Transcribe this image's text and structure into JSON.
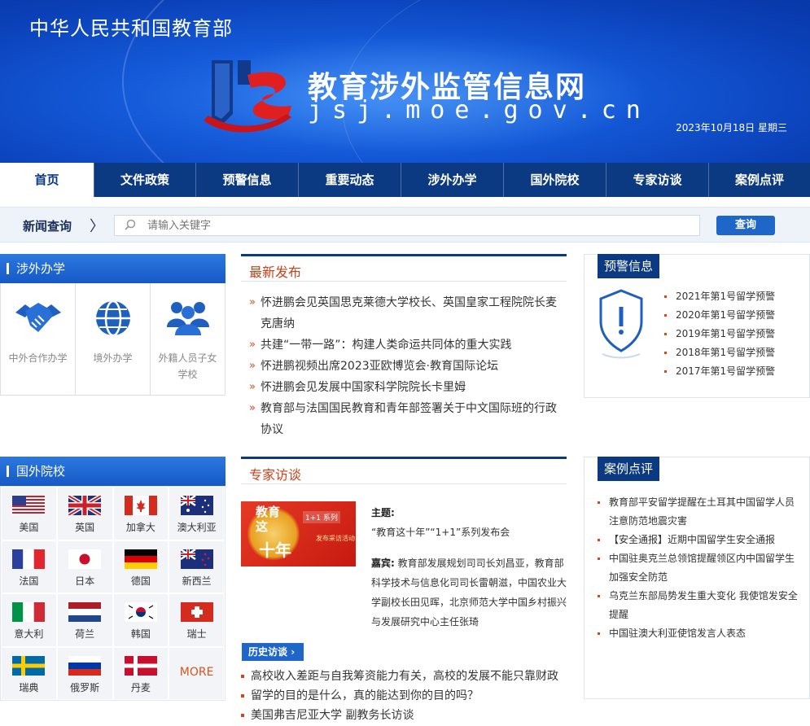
{
  "header": {
    "ministry": "中华人民共和国教育部",
    "site_title": "教育涉外监管信息网",
    "site_url": "jsj.moe.gov.cn",
    "date": "2023年10月18日  星期三"
  },
  "nav": {
    "items": [
      "首页",
      "文件政策",
      "预警信息",
      "重要动态",
      "涉外办学",
      "国外院校",
      "专家访谈",
      "案例点评"
    ],
    "active_index": 0
  },
  "search": {
    "label": "新闻查询",
    "placeholder": "请输入关键字",
    "button": "查询"
  },
  "edu": {
    "title": "涉外办学",
    "items": [
      {
        "label": "中外合作办学",
        "icon": "handshake-icon"
      },
      {
        "label": "境外办学",
        "icon": "globe-icon"
      },
      {
        "label": "外籍人员子女学校",
        "icon": "people-group-icon"
      }
    ]
  },
  "latest": {
    "title": "最新发布",
    "items": [
      "怀进鹏会见英国思克莱德大学校长、英国皇家工程院院长麦克唐纳",
      "共建“一带一路”：构建人类命运共同体的重大实践",
      "怀进鹏视频出席2023亚欧博览会·教育国际论坛",
      "怀进鹏会见发展中国家科学院院长卡里姆",
      "教育部与法国国民教育和青年部签署关于中文国际班的行政协议"
    ]
  },
  "warning": {
    "title": "预警信息",
    "items": [
      "2021年第1号留学预警",
      "2020年第1号留学预警",
      "2019年第1号留学预警",
      "2018年第1号留学预警",
      "2017年第1号留学预警"
    ]
  },
  "foreign": {
    "title": "国外院校",
    "countries": [
      {
        "name": "美国",
        "flag": "us-flag-icon"
      },
      {
        "name": "英国",
        "flag": "uk-flag-icon"
      },
      {
        "name": "加拿大",
        "flag": "canada-flag-icon"
      },
      {
        "name": "澳大利亚",
        "flag": "australia-flag-icon"
      },
      {
        "name": "法国",
        "flag": "france-flag-icon"
      },
      {
        "name": "日本",
        "flag": "japan-flag-icon"
      },
      {
        "name": "德国",
        "flag": "germany-flag-icon"
      },
      {
        "name": "新西兰",
        "flag": "newzealand-flag-icon"
      },
      {
        "name": "意大利",
        "flag": "italy-flag-icon"
      },
      {
        "name": "荷兰",
        "flag": "netherlands-flag-icon"
      },
      {
        "name": "韩国",
        "flag": "korea-flag-icon"
      },
      {
        "name": "瑞士",
        "flag": "switzerland-flag-icon"
      },
      {
        "name": "瑞典",
        "flag": "sweden-flag-icon"
      },
      {
        "name": "俄罗斯",
        "flag": "russia-flag-icon"
      },
      {
        "name": "丹麦",
        "flag": "denmark-flag-icon"
      }
    ],
    "more": "MORE"
  },
  "expert": {
    "title": "专家访谈",
    "image_text": {
      "line1": "教育这",
      "line2": "十年",
      "badge": "1+1 系列",
      "caption": "发布采访活动"
    },
    "topic_label": "主题:",
    "topic": "“教育这十年”“1+1”系列发布会",
    "guest_label": "嘉宾:",
    "guests": "教育部发展规划司司长刘昌亚，教育部科学技术与信息化司司长雷朝滋，中国农业大学副校长田见晖，北京师范大学中国乡村振兴与发展研究中心主任张琦",
    "history_button": "历史访谈",
    "history": [
      "高校收入差距与自我筹资能力有关，高校的发展不能只靠财政",
      "留学的目的是什么，真的能达到你的目的吗？",
      "美国弗吉尼亚大学 副教务长访谈"
    ]
  },
  "cases": {
    "title": "案例点评",
    "items": [
      "教育部平安留学提醒在土耳其中国留学人员注意防范地震灾害",
      "【安全通报】近期中国留学生安全通报",
      "中国驻奥克兰总领馆提醒领区内中国留学生加强安全防范",
      "乌克兰东部局势发生重大变化 我使馆发安全提醒",
      "中国驻澳大利亚使馆发言人表态"
    ]
  },
  "colors": {
    "nav_bg": "#0b3a82",
    "accent_orange": "#c9411a",
    "button_blue": "#1f66c9"
  }
}
